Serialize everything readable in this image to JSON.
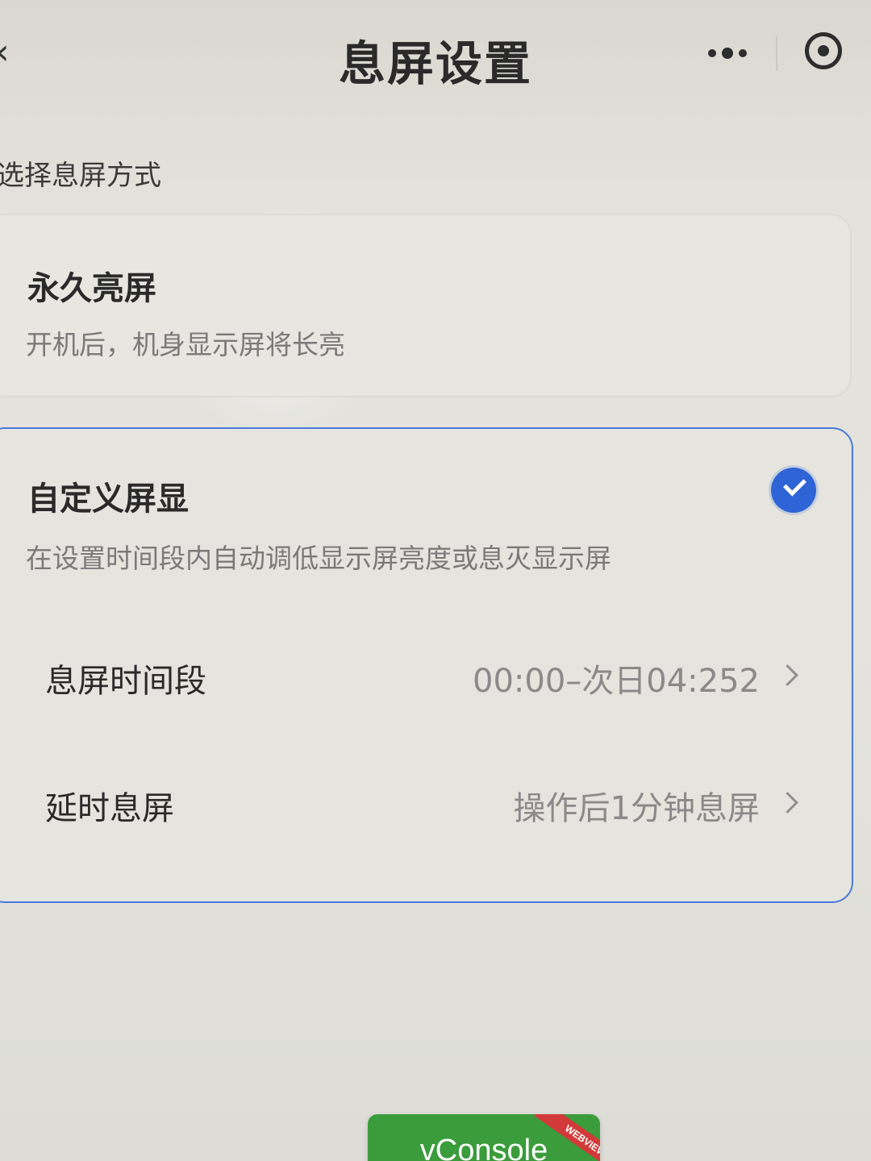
{
  "nav": {
    "title": "息屏设置",
    "back_glyph": "‹",
    "more_icon": "more-dots-icon",
    "close_icon": "target-circle-icon"
  },
  "section_label": "选择息屏方式",
  "options": {
    "permanent": {
      "title": "永久亮屏",
      "description": "开机后，机身显示屏将长亮",
      "selected": false
    },
    "custom": {
      "title": "自定义屏显",
      "description": "在设置时间段内自动调低显示屏亮度或息灭显示屏",
      "selected": true,
      "rows": {
        "timespan": {
          "label": "息屏时间段",
          "value": "00:00–次日04:252"
        },
        "delay": {
          "label": "延时息屏",
          "value": "操作后1分钟息屏"
        }
      }
    }
  },
  "vconsole": {
    "label": "vConsole",
    "ribbon": "WEBVIEW"
  },
  "colors": {
    "accent": "#2f64d6",
    "selected_border": "#4a7ad8",
    "vconsole_green": "#3a9c3a",
    "ribbon_red": "#d23a3a"
  }
}
